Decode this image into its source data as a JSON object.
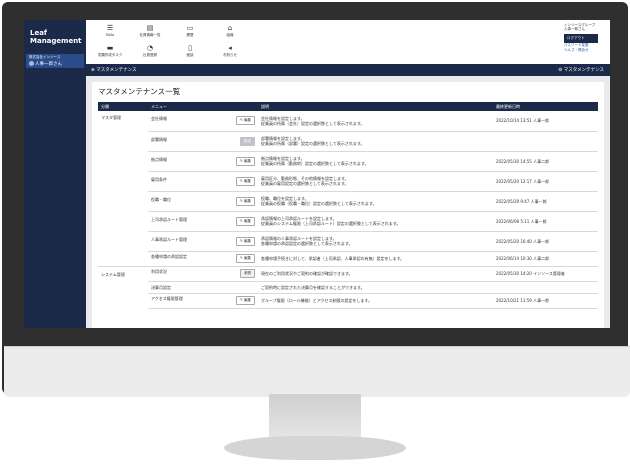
{
  "app": {
    "logo_line1": "Leaf",
    "logo_line2": "Management",
    "user_org": "株式会社インソース",
    "user_name": "人事一郎さん"
  },
  "toolbar": {
    "items": [
      {
        "icon": "☰",
        "label": "ToDo"
      },
      {
        "icon": "▤",
        "label": "社員情報一覧"
      },
      {
        "icon": "▭",
        "label": "履歴"
      },
      {
        "icon": "⌂",
        "label": "組織"
      },
      {
        "icon": "▬",
        "label": "書類作成タスク"
      },
      {
        "icon": "◔",
        "label": "社員登録"
      },
      {
        "icon": "▯",
        "label": "面談"
      },
      {
        "icon": "◂",
        "label": "お知らせ"
      }
    ]
  },
  "header_right": {
    "company": "インソースグループ",
    "user": "人事一郎さん",
    "logout": "ログアウト",
    "link1": "パスワード変更",
    "link2": "ヘルプ・問合せ"
  },
  "section": {
    "left_label": "マスタメンテナンス",
    "right_label": "マスタメンテナンス"
  },
  "page": {
    "title": "マスタメンテナンス一覧",
    "columns": [
      "分類",
      "メニュー",
      "説明",
      "最終更新日時"
    ]
  },
  "rows": [
    {
      "category": "マスタ管理",
      "menu": "会社情報",
      "btn": "編集",
      "desc1": "会社情報を設定します。",
      "desc2": "従業員の所属（会社）設定の選択肢として表示されます。",
      "updated": "2022/10/14 13:51 人事一郎"
    },
    {
      "category": "",
      "menu": "部署情報",
      "btn": "設定",
      "desc1": "部署情報を設定します。",
      "desc2": "従業員の所属（部署）設定の選択肢として表示されます。",
      "updated": ""
    },
    {
      "category": "",
      "menu": "拠点情報",
      "btn": "編集",
      "desc1": "拠点情報を設定します。",
      "desc2": "従業員の所属（勤務地）設定の選択肢として表示されます。",
      "updated": "2022/05/30 14:55 人事二郎"
    },
    {
      "category": "",
      "menu": "雇用条件",
      "btn": "編集",
      "desc1": "雇用区分、勤務形態、その他情報を設定します。",
      "desc2": "従業員の雇用設定の選択肢として表示されます。",
      "updated": "2022/05/20 12:17 人事一郎"
    },
    {
      "category": "",
      "menu": "役職・職位",
      "btn": "編集",
      "desc1": "役職、職位を設定します。",
      "desc2": "従業員の役職（役職・職位）設定の選択肢として表示されます。",
      "updated": "2022/05/29 9:47 人事一郎"
    },
    {
      "category": "",
      "menu": "上司承認ルート管理",
      "btn": "編集",
      "desc1": "承認情報の上司承認ルートを設定します。",
      "desc2": "従業員のシステム権限（上司承認ルート）設定の選択肢として表示されます。",
      "updated": "2022/06/08 5:11 人事一郎"
    },
    {
      "category": "",
      "menu": "人事承認ルート管理",
      "btn": "編集",
      "desc1": "承認情報の人事承認ルートを設定します。",
      "desc2": "各種申請の承認設定の選択肢として表示されます。",
      "updated": "2022/05/20 16:40 人事一郎"
    },
    {
      "category": "",
      "menu": "各種申請の承認設定",
      "btn": "編集",
      "desc1": "各種申請手続きに対して、承認者（上司承認、人事承認の有無）設定をします。",
      "desc2": "",
      "updated": "2022/06/14 10:30 人事二郎"
    },
    {
      "category": "システム管理",
      "menu": "利用状況",
      "btn": "参照",
      "desc1": "現在のご利用状況やご契約の確認が確認できます。",
      "desc2": "",
      "updated": "2022/05/30 14:20 インソース管理者"
    },
    {
      "category": "",
      "menu": "決算月設定",
      "btn": "",
      "desc1": "ご契約時に設定された決算月を確認することができます。",
      "desc2": "",
      "updated": ""
    },
    {
      "category": "",
      "menu": "アクセス権限管理",
      "btn": "編集",
      "desc1": "グループ権限（ロール機能）とアクセス制限の設定をします。",
      "desc2": "",
      "updated": "2022/10/21 11:59 人事一郎"
    }
  ]
}
